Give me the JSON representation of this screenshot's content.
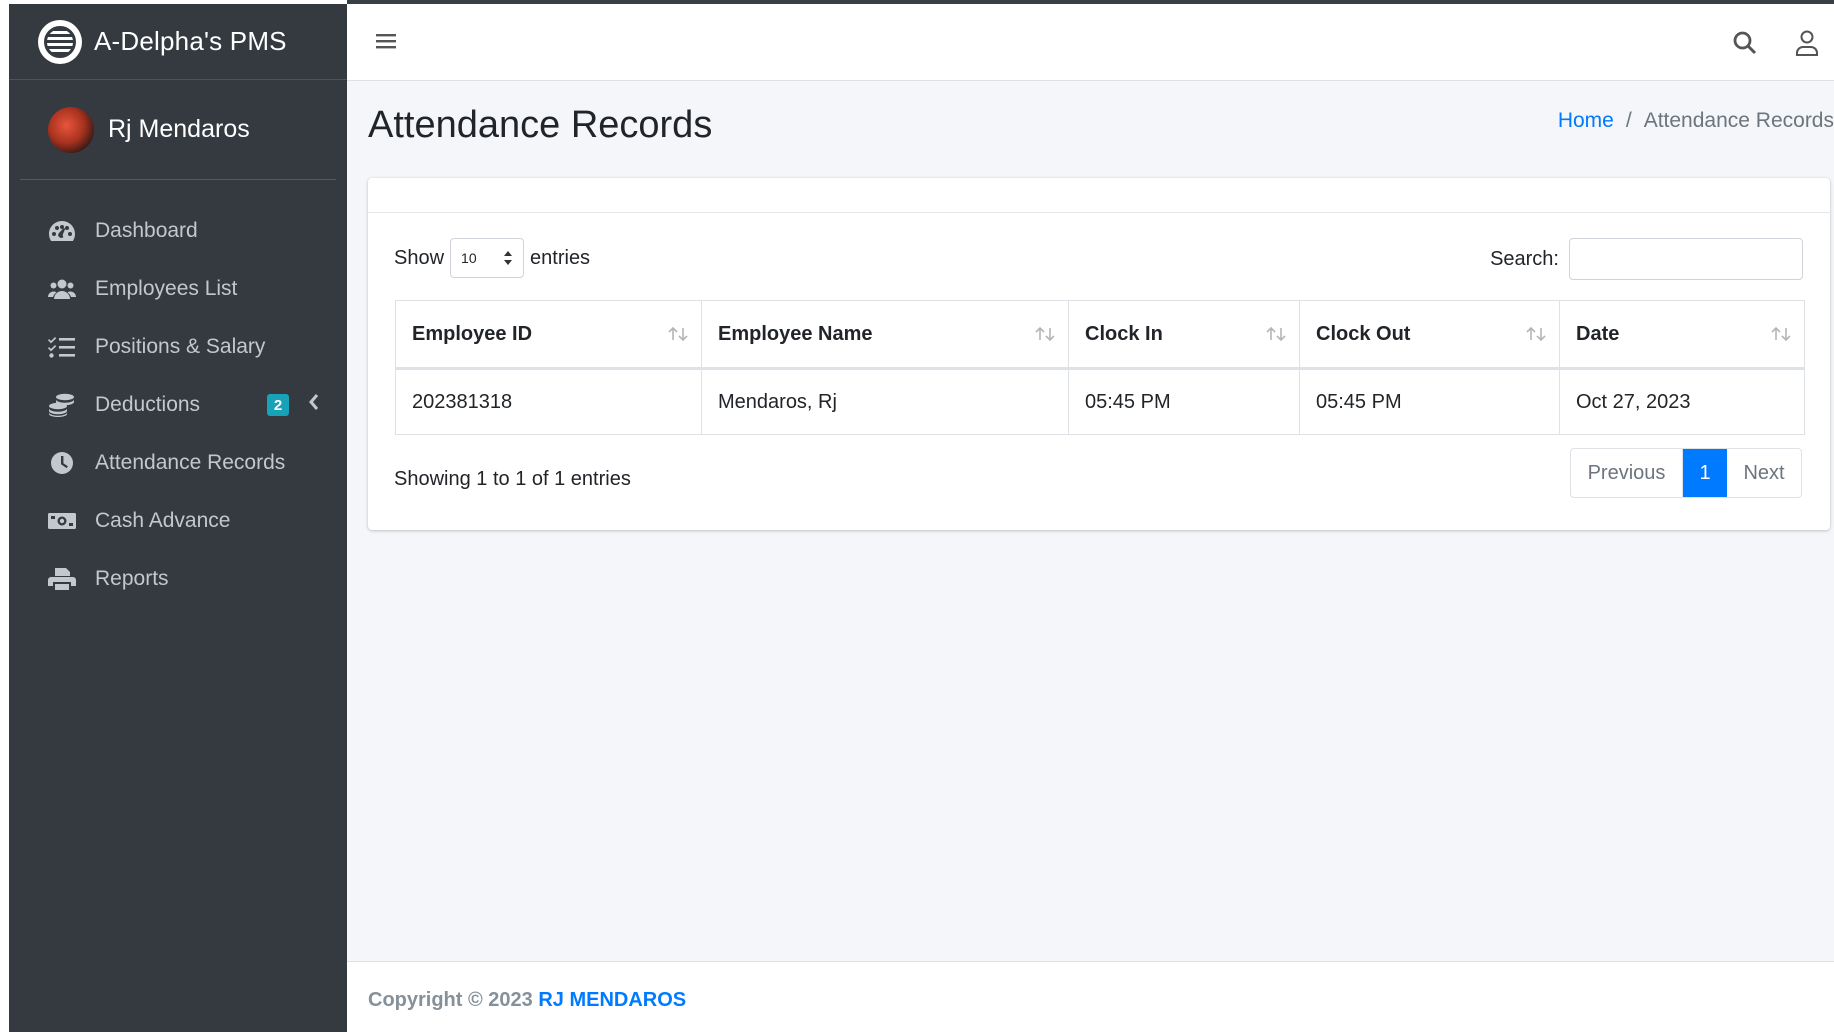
{
  "brand": {
    "name": "A-Delpha's PMS"
  },
  "user": {
    "name": "Rj Mendaros"
  },
  "sidebar": {
    "items": [
      {
        "label": "Dashboard",
        "icon": "dashboard-gauge-icon"
      },
      {
        "label": "Employees List",
        "icon": "users-icon"
      },
      {
        "label": "Positions & Salary",
        "icon": "list-check-icon"
      },
      {
        "label": "Deductions",
        "icon": "coins-icon",
        "badge": "2"
      },
      {
        "label": "Attendance Records",
        "icon": "clock-icon"
      },
      {
        "label": "Cash Advance",
        "icon": "money-bill-icon"
      },
      {
        "label": "Reports",
        "icon": "print-icon"
      }
    ]
  },
  "page": {
    "title": "Attendance Records",
    "breadcrumb": {
      "home": "Home",
      "separator": "/",
      "current": "Attendance Records"
    }
  },
  "table_controls": {
    "show_label": "Show",
    "entries_value": "10",
    "entries_label": "entries",
    "search_label": "Search:",
    "search_value": ""
  },
  "table": {
    "columns": [
      "Employee ID",
      "Employee Name",
      "Clock In",
      "Clock Out",
      "Date"
    ],
    "rows": [
      [
        "202381318",
        "Mendaros, Rj",
        "05:45 PM",
        "05:45 PM",
        "Oct 27, 2023"
      ]
    ],
    "info": "Showing 1 to 1 of 1 entries"
  },
  "pagination": {
    "previous": "Previous",
    "current": "1",
    "next": "Next"
  },
  "footer": {
    "prefix": "Copyright © 2023",
    "owner": "RJ MENDAROS"
  },
  "colors": {
    "sidebar": "#343a40",
    "accent": "#007bff",
    "badge": "#17a2b8",
    "content_bg": "#f4f6f9"
  }
}
